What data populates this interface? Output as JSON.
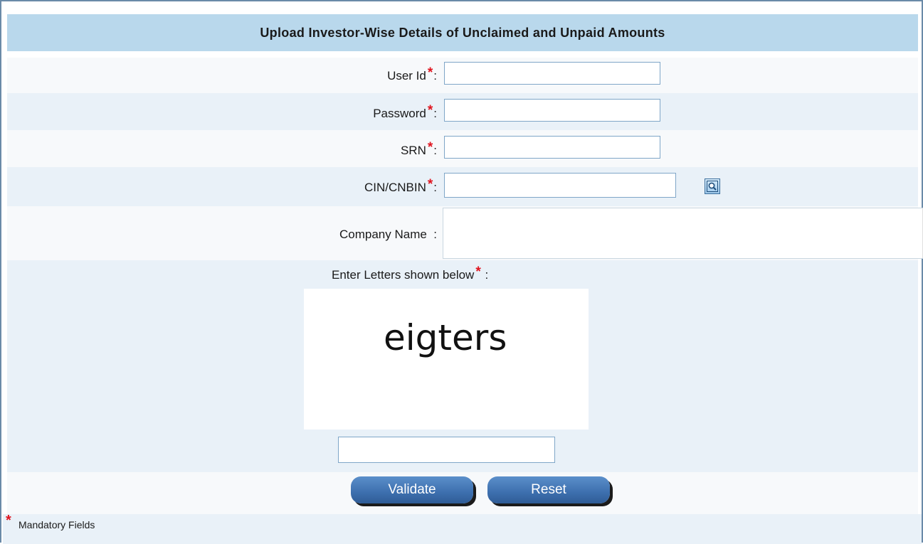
{
  "header": {
    "title": "Upload Investor-Wise Details of Unclaimed and Unpaid Amounts"
  },
  "fields": {
    "user_id": {
      "label": "User Id",
      "required_mark": "*",
      "colon": ":",
      "value": ""
    },
    "password": {
      "label": "Password",
      "required_mark": "*",
      "colon": ":",
      "value": ""
    },
    "srn": {
      "label": "SRN",
      "required_mark": "*",
      "colon": ":",
      "value": ""
    },
    "cin": {
      "label": "CIN/CNBIN",
      "required_mark": "*",
      "colon": ":",
      "value": "",
      "lookup_icon": "search-lookup-icon"
    },
    "company_name": {
      "label": "Company Name",
      "colon": ":",
      "value": ""
    }
  },
  "captcha": {
    "label": "Enter Letters shown below",
    "required_mark": "*",
    "colon": ":",
    "image_text": "eigters",
    "value": ""
  },
  "buttons": {
    "validate": "Validate",
    "reset": "Reset"
  },
  "footer": {
    "star": "*",
    "text": "Mandatory Fields"
  },
  "colors": {
    "header_bg": "#b9d8ec",
    "required": "#e0141e",
    "button": "#3d6fae"
  }
}
